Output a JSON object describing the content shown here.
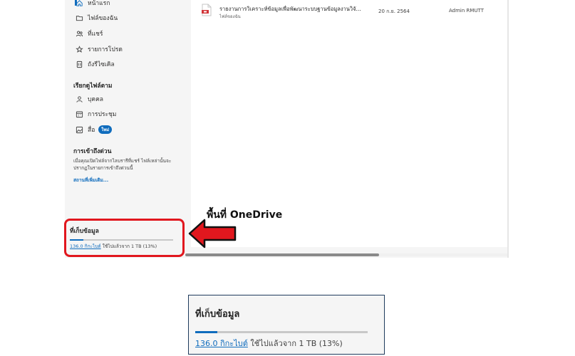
{
  "sidebar": {
    "nav": [
      {
        "label": "หน้าแรก",
        "icon": "home-icon"
      },
      {
        "label": "ไฟล์ของฉัน",
        "icon": "folder-icon"
      },
      {
        "label": "ที่แชร์",
        "icon": "people-icon"
      },
      {
        "label": "รายการโปรด",
        "icon": "star-icon"
      },
      {
        "label": "ถังรีไซเคิล",
        "icon": "trash-icon"
      }
    ],
    "browse_title": "เรียกดูไฟล์ตาม",
    "browse": [
      {
        "label": "บุคคล",
        "icon": "person-icon"
      },
      {
        "label": "การประชุม",
        "icon": "calendar-icon"
      },
      {
        "label": "สื่อ",
        "icon": "media-icon",
        "badge": "ใหม่"
      }
    ],
    "quick_access": {
      "title": "การเข้าถึงด่วน",
      "description": "เมื่อคุณเปิดไฟล์จากไลบรารีที่แชร์ ไฟล์เหล่านั้นจะปรากฏในรายการเข้าถึงด่วนนี้",
      "more_link": "สถานที่เพิ่มเติม..."
    },
    "storage": {
      "title": "ที่เก็บข้อมูล",
      "used": "136.0 กิกะไบต์",
      "rest": " ใช้ไปแล้วจาก 1 TB (13%)",
      "percent": 13
    }
  },
  "files": [
    {
      "name": "รายงานการวิเคราะห์ข้อมูลเพื่อพัฒนาระบบฐานข้อมูลงานวิจั...",
      "location": "ไฟล์ของฉัน",
      "date": "20 ก.ย. 2564",
      "owner": "Admin RMUTT",
      "icon": "pdf-file-icon"
    }
  ],
  "annotation": {
    "label": "พื้นที่ OneDrive",
    "highlight_color": "#e1171e"
  },
  "magnified": {
    "title": "ที่เก็บข้อมูล",
    "used": "136.0 กิกะไบต์",
    "rest": " ใช้ไปแล้วจาก 1 TB (13%)",
    "percent": 13
  },
  "colors": {
    "accent": "#0f6cbd",
    "sidebar_bg": "#f5f5f5"
  }
}
